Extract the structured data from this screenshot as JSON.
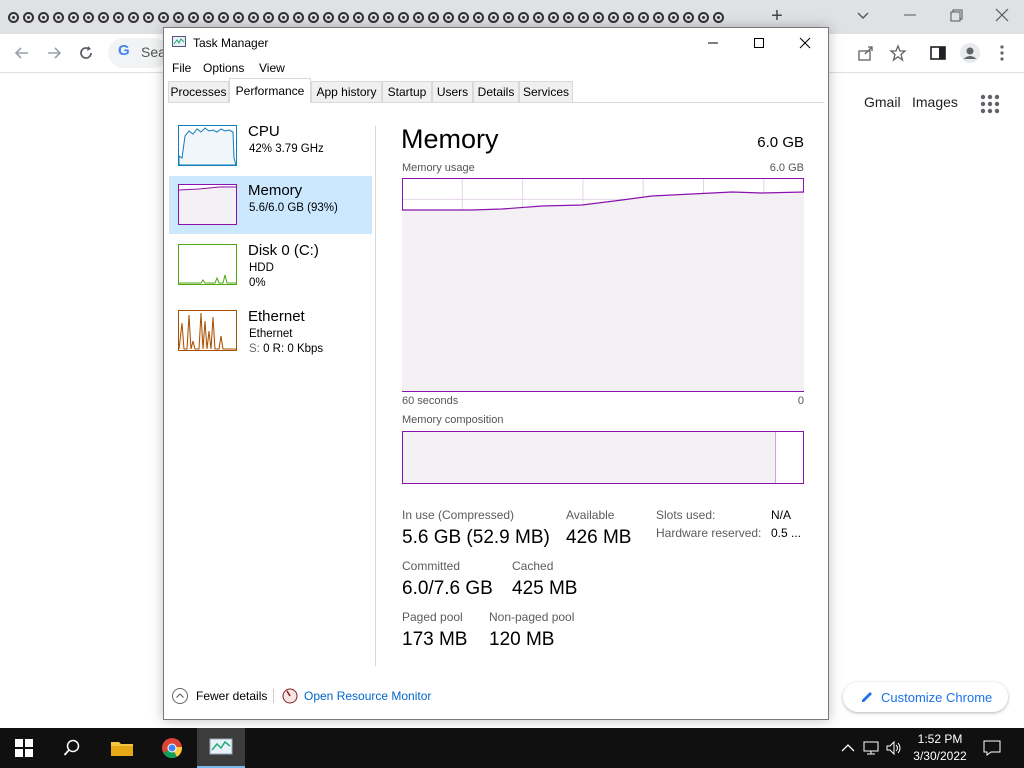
{
  "chrome": {
    "new_tab": "+",
    "omnibox_text": "Sea",
    "links": {
      "gmail": "Gmail",
      "images": "Images"
    },
    "customize_label": "Customize Chrome"
  },
  "task_manager": {
    "title": "Task Manager",
    "menu": [
      "File",
      "Options",
      "View"
    ],
    "tabs": [
      "Processes",
      "Performance",
      "App history",
      "Startup",
      "Users",
      "Details",
      "Services"
    ],
    "active_tab": "Performance",
    "resources": [
      {
        "name": "CPU",
        "sub1": "42%  3.79 GHz",
        "sub2": "",
        "color": "#117dbb"
      },
      {
        "name": "Memory",
        "sub1": "5.6/6.0 GB (93%)",
        "sub2": "",
        "color": "#8b12ae",
        "active": true
      },
      {
        "name": "Disk 0 (C:)",
        "sub1": "HDD",
        "sub2": "0%",
        "color": "#4da60c"
      },
      {
        "name": "Ethernet",
        "sub1": "Ethernet",
        "sub2_label": "S:",
        "sub2": "0  R:  0 Kbps",
        "color": "#a74f01"
      }
    ],
    "panel": {
      "title": "Memory",
      "total": "6.0 GB",
      "usage_label": "Memory usage",
      "usage_max": "6.0 GB",
      "axis_left": "60 seconds",
      "axis_right": "0",
      "composition_label": "Memory composition",
      "composition_used_fraction": 0.93
    },
    "stats": {
      "in_use_label": "In use (Compressed)",
      "in_use": "5.6 GB (52.9 MB)",
      "available_label": "Available",
      "available": "426 MB",
      "committed_label": "Committed",
      "committed": "6.0/7.6 GB",
      "cached_label": "Cached",
      "cached": "425 MB",
      "paged_label": "Paged pool",
      "paged": "173 MB",
      "nonpaged_label": "Non-paged pool",
      "nonpaged": "120 MB",
      "slots_label": "Slots used:",
      "slots": "N/A",
      "hw_reserved_label": "Hardware reserved:",
      "hw_reserved": "0.5 ..."
    },
    "footer": {
      "fewer_details": "Fewer details",
      "open_resource_monitor": "Open Resource Monitor"
    }
  },
  "taskbar": {
    "time": "1:52 PM",
    "date": "3/30/2022",
    "apps": [
      "start-icon",
      "search-icon",
      "file-explorer-icon",
      "chrome-icon",
      "task-manager-icon"
    ]
  }
}
